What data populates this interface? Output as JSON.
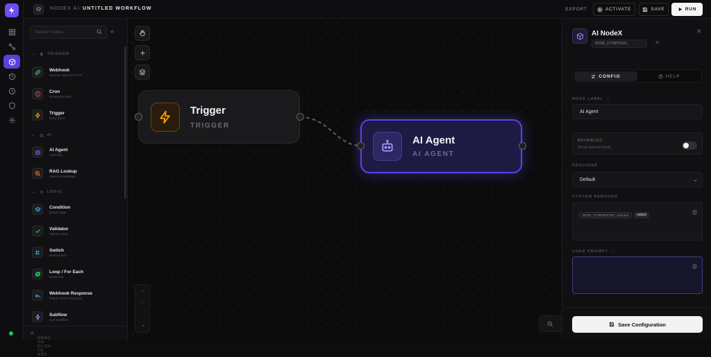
{
  "app": {
    "brand": "NODEX AI",
    "separator": "/",
    "workflow_title": "UNTITLED WORKFLOW"
  },
  "toolbar": {
    "export": "EXPORT",
    "activate": "ACTIVATE",
    "save": "SAVE",
    "run": "RUN"
  },
  "sidebar": {
    "search_placeholder": "Search nodes...",
    "sections": {
      "trigger": "TRIGGER",
      "ai": "AI",
      "logic": "LOGIC"
    },
    "items": [
      {
        "name": "Webhook",
        "desc": "Receive data via HTTP",
        "icon": "link-icon",
        "color": "#3ddc84"
      },
      {
        "name": "Cron",
        "desc": "Scheduled task",
        "icon": "clock-icon",
        "color": "#ef4444"
      },
      {
        "name": "Trigger",
        "desc": "Entry point",
        "icon": "bolt-icon",
        "color": "#f59e0b"
      },
      {
        "name": "AI Agent",
        "desc": "LLM step",
        "icon": "robot-icon",
        "color": "#8b5cf6"
      },
      {
        "name": "RAG Lookup",
        "desc": "Search knowledge",
        "icon": "search-zoom-icon",
        "color": "#f97316"
      },
      {
        "name": "Condition",
        "desc": "Branch logic",
        "icon": "layers-icon",
        "color": "#38bdf8"
      },
      {
        "name": "Validator",
        "desc": "Validate data",
        "icon": "check-icon",
        "color": "#22c55e"
      },
      {
        "name": "Switch",
        "desc": "Multi-branch",
        "icon": "switch-icon",
        "color": "#38bdf8"
      },
      {
        "name": "Loop / For Each",
        "desc": "Iterate list",
        "icon": "loop-icon",
        "color": "#22c55e"
      },
      {
        "name": "Webhook Response",
        "desc": "Return HTTP response",
        "icon": "reply-icon",
        "color": "#38bdf8"
      },
      {
        "name": "Subflow",
        "desc": "Call workflow",
        "icon": "subflow-icon",
        "color": "#a78bfa"
      }
    ],
    "footer": "DRAG OR CLICK TO ADD"
  },
  "canvas": {
    "nodes": [
      {
        "title": "Trigger",
        "subtitle": "TRIGGER"
      },
      {
        "title": "AI Agent",
        "subtitle": "AI AGENT"
      }
    ]
  },
  "inspector": {
    "title": "AI NodeX",
    "node_id": "NODE_1775875319...",
    "dot": "·",
    "type": "AI",
    "tabs": {
      "config": "CONFIG",
      "help": "HELP"
    },
    "node_label_label": "NODE LABEL",
    "node_label_value": "AI Agent",
    "advanced_title": "ADVANCED",
    "advanced_desc": "Show optional fields",
    "provider_label": "PROVIDER",
    "provider_value": "Default",
    "system_persona_label": "SYSTEM PERSONA",
    "persona_chip_id": "NODE_1775875317827_4311343",
    "persona_chip_field": "output",
    "user_prompt_label": "USER PROMPT",
    "save_button": "Save Configuration"
  },
  "colors": {
    "accent": "#5b3fe0",
    "node_selected": "#5a43ec",
    "trigger": "#f59e0b"
  }
}
